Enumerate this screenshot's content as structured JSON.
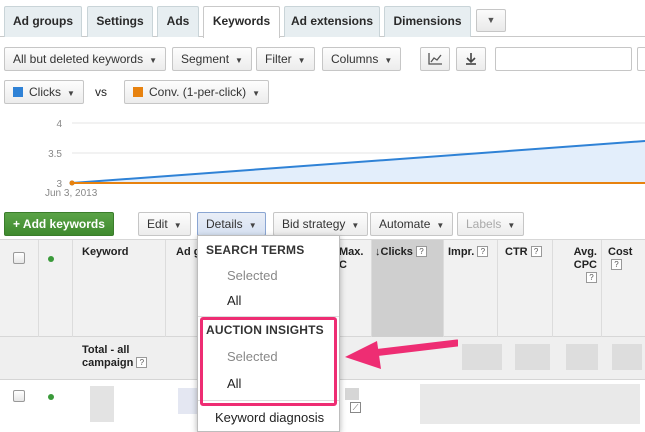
{
  "tabs": [
    {
      "label": "Ad groups"
    },
    {
      "label": "Settings"
    },
    {
      "label": "Ads"
    },
    {
      "label": "Keywords"
    },
    {
      "label": "Ad extensions"
    },
    {
      "label": "Dimensions"
    }
  ],
  "tabs_more": "▼",
  "toolbar": {
    "filter_all": "All but deleted keywords",
    "segment": "Segment",
    "filter": "Filter",
    "columns": "Columns",
    "chart_icon": "line-chart-icon",
    "download_icon": "download-icon"
  },
  "metrics": {
    "metric1": "Clicks",
    "metric1_color": "#2f82d6",
    "vs": "vs",
    "metric2": "Conv. (1-per-click)",
    "metric2_color": "#e7820f"
  },
  "chart_data": {
    "type": "line",
    "x": [
      "Jun 3, 2013",
      ""
    ],
    "series": [
      {
        "values": [
          3,
          3.7
        ],
        "color": "#2f82d6"
      },
      {
        "values": [
          3,
          3
        ],
        "color": "#e7820f"
      }
    ],
    "ylim": [
      3,
      4
    ],
    "yticks": [
      "4",
      "3.5",
      "3"
    ],
    "xtick_label": "Jun 3, 2013"
  },
  "actions": {
    "add_keywords": "+ Add keywords",
    "edit": "Edit",
    "details": "Details",
    "bid_strategy": "Bid strategy",
    "automate": "Automate",
    "labels": "Labels"
  },
  "table": {
    "headers": {
      "keyword": "Keyword",
      "ad_group": "Ad g",
      "max_cpc": "Max.\nC",
      "clicks": "↓Clicks",
      "impr": "Impr.",
      "ctr": "CTR",
      "avg_cpc": "Avg. CPC",
      "cost": "Cost"
    },
    "total_label": "Total - all campaign"
  },
  "details_menu": {
    "section1": "SEARCH TERMS",
    "section1_items": [
      "Selected",
      "All"
    ],
    "section2": "AUCTION INSIGHTS",
    "section2_items": [
      "Selected",
      "All"
    ],
    "keyword_diagnosis": "Keyword diagnosis"
  },
  "colors": {
    "highlight": "#ee2d73",
    "add_button": "#4a9a3a"
  }
}
